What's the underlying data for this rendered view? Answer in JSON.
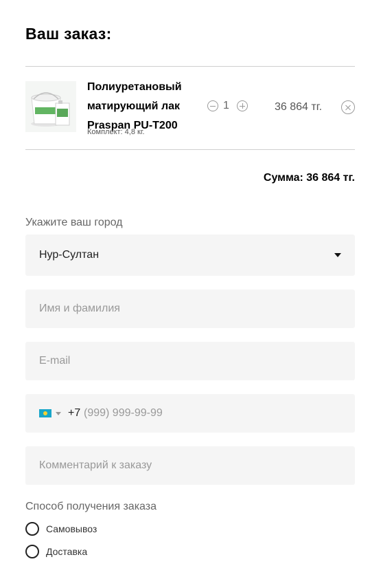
{
  "order": {
    "title": "Ваш заказ:",
    "sum_text": "Сумма: 36 864 тг."
  },
  "item": {
    "name": "Полиуретановый матирующий лак Praspan PU-T200",
    "kit": "Комплект: 4,8 кг.",
    "quantity": "1",
    "price": "36 864 тг.",
    "image": "product-bucket-and-can"
  },
  "form": {
    "city_label": "Укажите ваш город",
    "city_value": "Нур-Султан",
    "name_placeholder": "Имя и фамилия",
    "email_placeholder": "E-mail",
    "phone_prefix": "+7",
    "phone_placeholder": "(999) 999-99-99",
    "phone_flag": "kazakhstan-flag",
    "comment_placeholder": "Комментарий к заказу",
    "delivery_label": "Способ получения заказа",
    "delivery_options": [
      "Самовывоз",
      "Доставка"
    ]
  },
  "colors": {
    "field_bg": "#f5f5f5",
    "divider": "#cfcfcf"
  }
}
